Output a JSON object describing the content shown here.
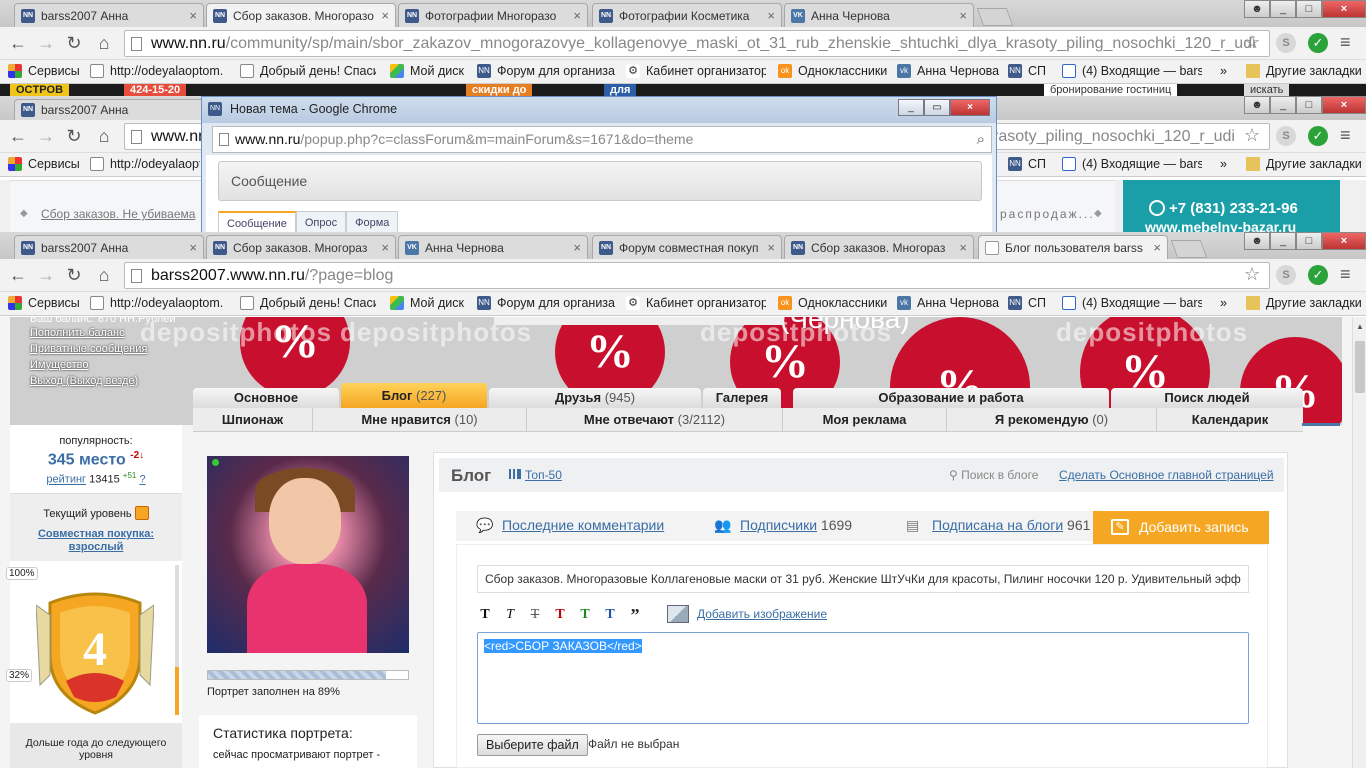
{
  "window1": {
    "tabs": [
      {
        "title": "barss2007 Анна",
        "icon": "nn-icon"
      },
      {
        "title": "Сбор заказов. Многоразо",
        "icon": "nn-icon"
      },
      {
        "title": "Фотографии Многоразо",
        "icon": "nn-icon"
      },
      {
        "title": "Фотографии Косметика",
        "icon": "nn-icon"
      },
      {
        "title": "Анна Чернова",
        "icon": "vk-icon"
      }
    ],
    "url_domain": "www.nn.ru",
    "url_path": "/community/sp/main/sbor_zakazov_mnogorazovye_kollagenovye_maski_ot_31_rub_zhenskie_shtuchki_dlya_krasoty_piling_nosochki_120_r_udi",
    "page_strip": [
      "OCTPOB",
      "424-15-20",
      "скидки до",
      "для"
    ],
    "right_text": "бронирование гостиниц",
    "right_btn": "искать"
  },
  "bookmarks": [
    {
      "label": "Сервисы",
      "icon": "apps-icon"
    },
    {
      "label": "http://odeyalaoptom.",
      "icon": "page-icon"
    },
    {
      "label": "Добрый день! Спаси",
      "icon": "page-icon"
    },
    {
      "label": "Мой диск",
      "icon": "drive-icon"
    },
    {
      "label": "Форум для организат",
      "icon": "nn-icon"
    },
    {
      "label": "Кабинет организатор",
      "icon": "cabinet-icon"
    },
    {
      "label": "Одноклассники",
      "icon": "ok-icon"
    },
    {
      "label": "Анна Чернова",
      "icon": "vk-icon"
    },
    {
      "label": "СП",
      "icon": "nn-icon"
    },
    {
      "label": "(4) Входящие — barss",
      "icon": "mail-icon"
    }
  ],
  "bookmarks_more": "»",
  "bookmarks_other": "Другие закладки",
  "window2": {
    "tab": "barss2007 Анна",
    "url_domain": "www.nn.",
    "url_tail": "rasoty_piling_nosochki_120_r_udi",
    "bookmarks_short": [
      {
        "label": "Сервисы"
      },
      {
        "label": "http://odeyalaopt"
      }
    ],
    "bookmarks_right": [
      {
        "label": "СП"
      },
      {
        "label": "(4) Входящие — bars"
      }
    ],
    "crumb": "Сбор заказов. Не убиваема",
    "crumb_right": "распродаж...",
    "phone": "+7 (831) 233-21-96",
    "site": "www.mebelny-bazar.ru"
  },
  "popup": {
    "title": "Новая тема - Google Chrome",
    "url_domain": "www.nn.ru",
    "url_path": "/popup.php?c=classForum&m=mainForum&s=1671&do=theme",
    "message_label": "Сообщение",
    "tabs": [
      "Сообщение",
      "Опрос",
      "Форма"
    ]
  },
  "window3": {
    "tabs": [
      {
        "title": "barss2007 Анна",
        "icon": "nn-icon"
      },
      {
        "title": "Сбор заказов. Многораз",
        "icon": "nn-icon"
      },
      {
        "title": "Анна Чернова",
        "icon": "vk-icon"
      },
      {
        "title": "Форум совместная покуп",
        "icon": "nn-icon"
      },
      {
        "title": "Сбор заказов. Многораз",
        "icon": "nn-icon"
      },
      {
        "title": "Блог пользователя barss",
        "icon": "page-icon"
      }
    ],
    "url_domain": "barss2007.www.nn.ru",
    "url_path": "/?page=blog"
  },
  "profile": {
    "balance_line": "Ваш баланс: 870 НН.Рублей",
    "links": [
      "Пополнить баланс",
      "Приватные сообщения",
      "Имущество"
    ],
    "logout": "Выход",
    "logout_all": "(Выход везде)",
    "banner_name": "(Чернова)",
    "watermark": "depositphotos"
  },
  "nav_tabs": [
    {
      "label": "Основное",
      "count": ""
    },
    {
      "label": "Блог",
      "count": "(227)"
    },
    {
      "label": "Друзья",
      "count": "(945)"
    },
    {
      "label": "Галерея",
      "count": ""
    },
    {
      "label": "Образование и работа",
      "count": ""
    },
    {
      "label": "Поиск людей",
      "count": ""
    }
  ],
  "sub_tabs": [
    {
      "label": "Шпионаж",
      "count": ""
    },
    {
      "label": "Мне нравится",
      "count": "(10)"
    },
    {
      "label": "Мне отвечают",
      "count": "(3/2112)"
    },
    {
      "label": "Моя реклама",
      "count": ""
    },
    {
      "label": "Я рекомендую",
      "count": "(0)"
    },
    {
      "label": "Календарик",
      "count": ""
    }
  ],
  "sidebar": {
    "popularity_label": "популярность:",
    "rank": "345 место",
    "rank_delta": "-2↓",
    "rating_label": "рейтинг",
    "rating_value": "13415",
    "rating_delta": "+51",
    "rating_help": "?",
    "level_label": "Текущий уровень",
    "level_name": "Совместная покупка: взрослый",
    "pct_top": "100%",
    "pct_mid": "32%",
    "level_number": "4",
    "level_progress": 0.32,
    "next_level": "Дольше года до следующего уровня"
  },
  "portrait": {
    "fill_label": "Портрет заполнен на 89%",
    "fill": 0.89,
    "stats_title": "Статистика портрета:",
    "stats_line": "сейчас просматривают портрет -"
  },
  "blog": {
    "title": "Блог",
    "top": "Топ-50",
    "search": "Поиск в блоге",
    "make_main": "Сделать Основное главной страницей",
    "recent_comments": "Последние комментарии",
    "subscribers_label": "Подписчики",
    "subscribers": "1699",
    "subscribed_label": "Подписана на блоги",
    "subscribed": "961",
    "add_post": "Добавить запись",
    "post_title": "Сбор заказов. Многоразовые Коллагеновые маски от 31 руб. Женские ШтУчКи для красоты, Пилинг носочки 120 р. Удивительный эфф",
    "format_buttons": [
      "T",
      "T",
      "T",
      "T",
      "T",
      "T",
      "”"
    ],
    "format_colors": [
      "#111111",
      "#111111",
      "#555555",
      "#cc0000",
      "#1a8a1a",
      "#2255aa",
      "#111111"
    ],
    "add_image": "Добавить изображение",
    "body_text": "<red>СБОР ЗАКАЗОВ</red>",
    "file_button": "Выберите файл",
    "file_status": "Файл не выбран"
  }
}
